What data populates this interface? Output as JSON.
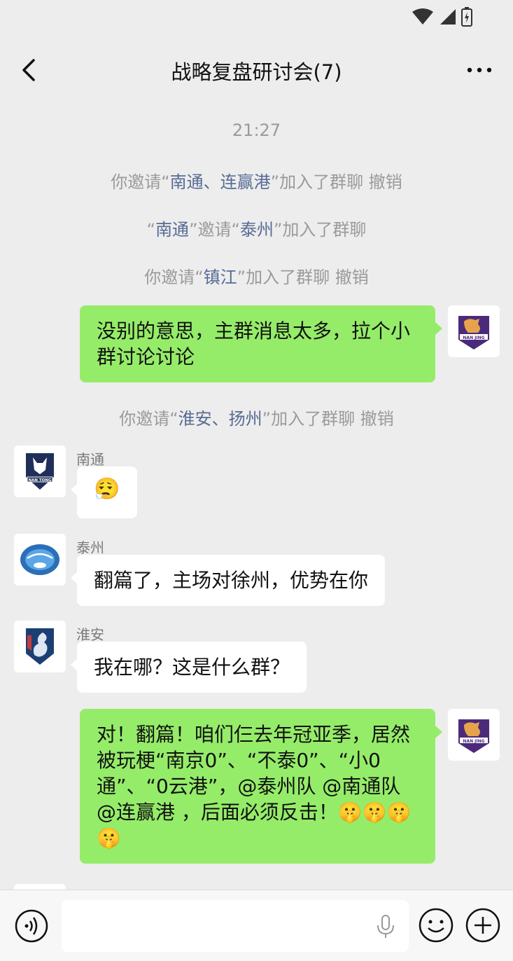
{
  "header": {
    "title": "战略复盘研讨会(7)"
  },
  "chat": {
    "timestamp": "21:27",
    "sys1": {
      "pre": "你邀请“",
      "names": "南通、连赢港",
      "post": "”加入了群聊",
      "action": "撤销"
    },
    "sys2": {
      "q1": "“",
      "name1": "南通",
      "mid": "”邀请“",
      "name2": "泰州",
      "post": "”加入了群聊"
    },
    "sys3": {
      "pre": "你邀请“",
      "names": "镇江",
      "post": "”加入了群聊",
      "action": "撤销"
    },
    "msg1": {
      "text": "没别的意思，主群消息太多，拉个小群讨论讨论"
    },
    "sys4": {
      "pre": "你邀请“",
      "names": "淮安、扬州",
      "post": "”加入了群聊",
      "action": "撤销"
    },
    "msg2": {
      "sender": "南通",
      "emoji": "😮‍💨"
    },
    "msg3": {
      "sender": "泰州",
      "text": "翻篇了，主场对徐州，优势在你"
    },
    "msg4": {
      "sender": "淮安",
      "text": "我在哪？这是什么群？"
    },
    "msg5": {
      "text": "对！翻篇！咱们仨去年冠亚季，居然被玩梗“南京0”、“不泰0”、“小0通”、“0云港”，@泰州队 @南通队 @连赢港 ，后面必须反击！🤫🤫🤫🤫"
    },
    "avatars": {
      "self": "NAN JING",
      "nantong": "NAN TONG"
    }
  },
  "colors": {
    "accent_green": "#95ec69",
    "link_blue": "#576b95"
  }
}
